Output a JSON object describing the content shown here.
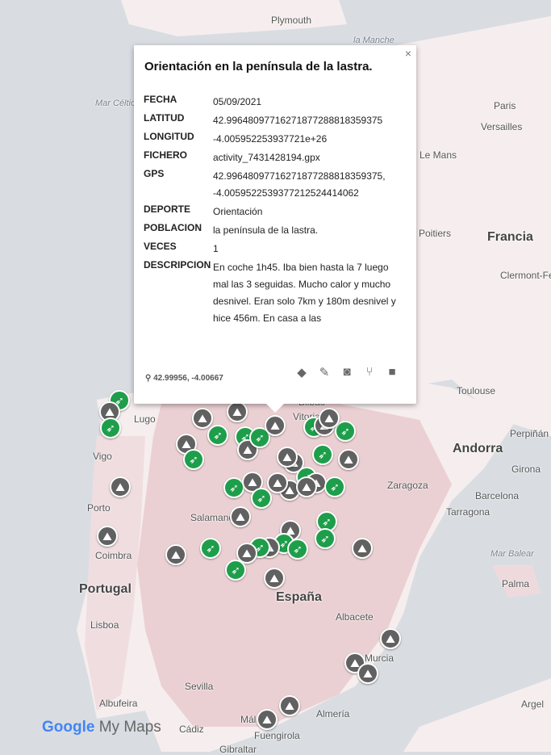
{
  "map": {
    "colors": {
      "sea": "#d9dde2",
      "land": "#f6eeee",
      "region": "#e8c8cc"
    },
    "places": [
      {
        "name": "Plymouth",
        "class": ""
      },
      {
        "name": "Mar Céltic",
        "class": "sea"
      },
      {
        "name": "la Manche",
        "class": "sea"
      },
      {
        "name": "Paris",
        "class": ""
      },
      {
        "name": "Versailles",
        "class": ""
      },
      {
        "name": "Le Mans",
        "class": ""
      },
      {
        "name": "Poitiers",
        "class": ""
      },
      {
        "name": "Francia",
        "class": "country"
      },
      {
        "name": "Clermont-Ferr",
        "class": ""
      },
      {
        "name": "Toulouse",
        "class": ""
      },
      {
        "name": "Andorra",
        "class": "country"
      },
      {
        "name": "Perpiñán",
        "class": ""
      },
      {
        "name": "Girona",
        "class": ""
      },
      {
        "name": "Zaragoza",
        "class": ""
      },
      {
        "name": "Barcelona",
        "class": ""
      },
      {
        "name": "Tarragona",
        "class": ""
      },
      {
        "name": "Mar Balear",
        "class": "sea"
      },
      {
        "name": "Palma",
        "class": ""
      },
      {
        "name": "Vitoria",
        "class": ""
      },
      {
        "name": "Bilbao",
        "class": ""
      },
      {
        "name": "Lugo",
        "class": ""
      },
      {
        "name": "Vigo",
        "class": ""
      },
      {
        "name": "Porto",
        "class": ""
      },
      {
        "name": "Coimbra",
        "class": ""
      },
      {
        "name": "Portugal",
        "class": "country"
      },
      {
        "name": "Lisboa",
        "class": ""
      },
      {
        "name": "Salamanca",
        "class": ""
      },
      {
        "name": "España",
        "class": "country"
      },
      {
        "name": "Albacete",
        "class": ""
      },
      {
        "name": "Murcia",
        "class": ""
      },
      {
        "name": "Sevilla",
        "class": ""
      },
      {
        "name": "Albufeira",
        "class": ""
      },
      {
        "name": "Cádiz",
        "class": ""
      },
      {
        "name": "Málaga",
        "class": ""
      },
      {
        "name": "Fuengirola",
        "class": ""
      },
      {
        "name": "Almería",
        "class": ""
      },
      {
        "name": "Gibraltar",
        "class": ""
      },
      {
        "name": "Argel",
        "class": ""
      }
    ],
    "markers": {
      "green_count": 34,
      "gray_count": 44
    }
  },
  "popup": {
    "close_label": "×",
    "title": "Orientación en la península de la lastra.",
    "fields": [
      {
        "key": "FECHA",
        "value": "05/09/2021"
      },
      {
        "key": "LATITUD",
        "value": "42.99648097716271877288818359375"
      },
      {
        "key": "LONGITUD",
        "value": "-4.005952253937721e+26"
      },
      {
        "key": "FICHERO",
        "value": "activity_7431428194.gpx"
      },
      {
        "key": "GPS",
        "value": "42.99648097716271877288818359375, -4.0059522539377212524414062"
      },
      {
        "key": "DEPORTE",
        "value": "Orientación"
      },
      {
        "key": "POBLACION",
        "value": "la península de la lastra."
      },
      {
        "key": "VECES",
        "value": "1"
      },
      {
        "key": "DESCRIPCION",
        "value": "En coche 1h45. Iba bien hasta la 7 luego mal las 3 seguidas. Mucho calor y mucho desnivel. Eran solo 7km y 180m desnivel y hice 456m. En casa a las"
      }
    ],
    "coords": "42.99956, -4.00667",
    "tools": [
      {
        "name": "paint-bucket-icon",
        "glyph": "◆"
      },
      {
        "name": "pencil-icon",
        "glyph": "✎"
      },
      {
        "name": "camera-icon",
        "glyph": "◙"
      },
      {
        "name": "route-icon",
        "glyph": "⑂"
      },
      {
        "name": "trash-icon",
        "glyph": "■"
      }
    ]
  },
  "logo": {
    "google": "Google",
    "mymaps": "My Maps"
  }
}
